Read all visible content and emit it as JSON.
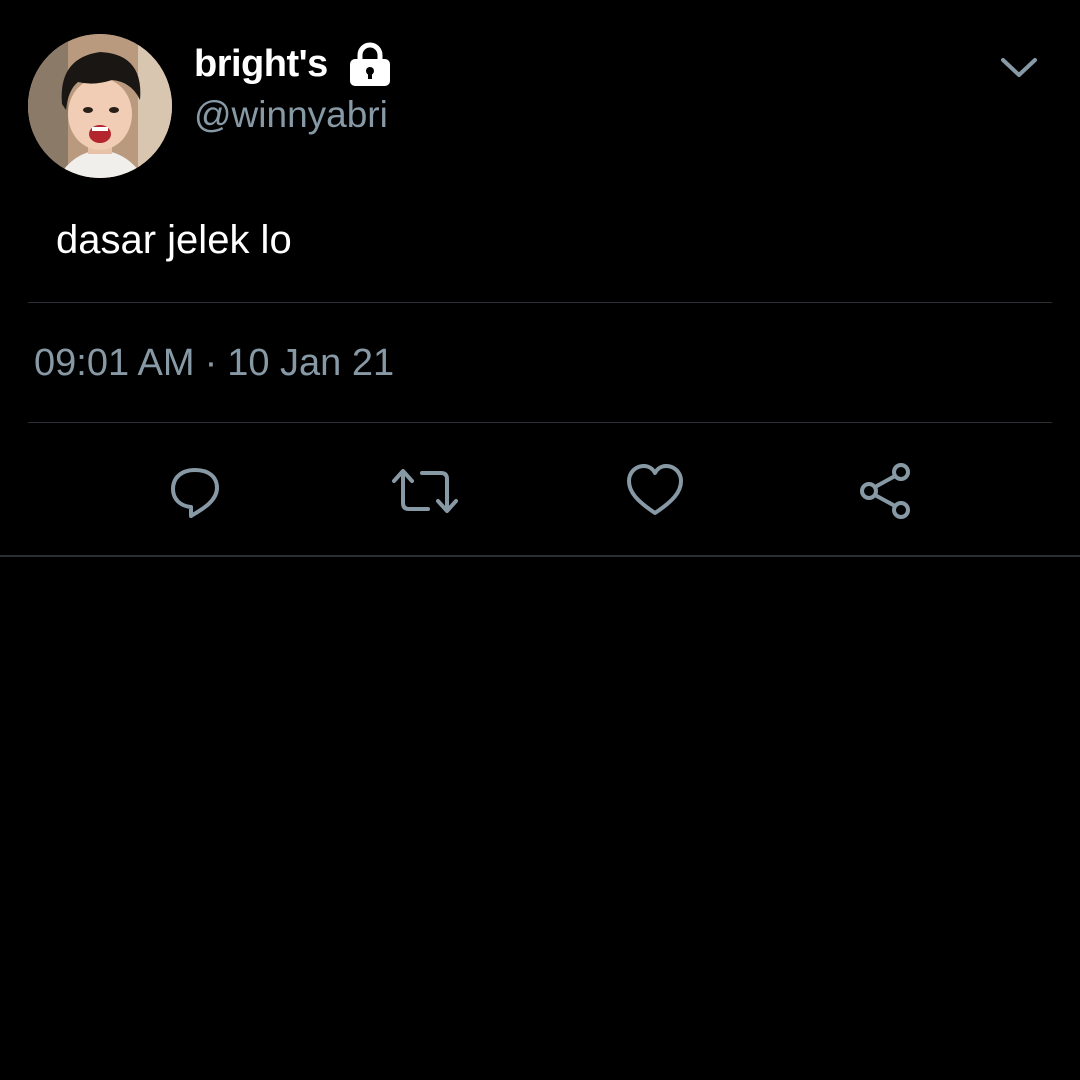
{
  "tweet": {
    "author": {
      "display_name": "bright's",
      "handle": "@winnyabri",
      "protected_icon": "lock-icon",
      "avatar_icon": "profile-photo"
    },
    "menu_icon": "chevron-down-icon",
    "text": "dasar jelek lo",
    "time": "09:01 AM",
    "separator": "·",
    "date": "10 Jan 21",
    "actions": [
      {
        "name": "reply",
        "icon": "comment-bubble-icon"
      },
      {
        "name": "retweet",
        "icon": "retweet-icon"
      },
      {
        "name": "like",
        "icon": "heart-icon"
      },
      {
        "name": "share",
        "icon": "share-icon"
      }
    ]
  },
  "colors": {
    "background": "#000000",
    "primary_text": "#ffffff",
    "secondary_text": "#8899a6",
    "icon": "#8899a6",
    "divider": "#2b2f33"
  }
}
